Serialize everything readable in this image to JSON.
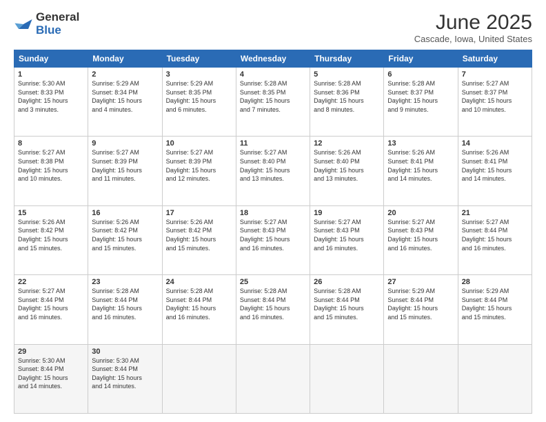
{
  "logo": {
    "general": "General",
    "blue": "Blue"
  },
  "title": "June 2025",
  "subtitle": "Cascade, Iowa, United States",
  "headers": [
    "Sunday",
    "Monday",
    "Tuesday",
    "Wednesday",
    "Thursday",
    "Friday",
    "Saturday"
  ],
  "weeks": [
    [
      {
        "day": "1",
        "rise": "5:30 AM",
        "set": "8:33 PM",
        "daylight": "15 hours and 3 minutes."
      },
      {
        "day": "2",
        "rise": "5:29 AM",
        "set": "8:34 PM",
        "daylight": "15 hours and 4 minutes."
      },
      {
        "day": "3",
        "rise": "5:29 AM",
        "set": "8:35 PM",
        "daylight": "15 hours and 6 minutes."
      },
      {
        "day": "4",
        "rise": "5:28 AM",
        "set": "8:35 PM",
        "daylight": "15 hours and 7 minutes."
      },
      {
        "day": "5",
        "rise": "5:28 AM",
        "set": "8:36 PM",
        "daylight": "15 hours and 8 minutes."
      },
      {
        "day": "6",
        "rise": "5:28 AM",
        "set": "8:37 PM",
        "daylight": "15 hours and 9 minutes."
      },
      {
        "day": "7",
        "rise": "5:27 AM",
        "set": "8:37 PM",
        "daylight": "15 hours and 10 minutes."
      }
    ],
    [
      {
        "day": "8",
        "rise": "5:27 AM",
        "set": "8:38 PM",
        "daylight": "15 hours and 10 minutes."
      },
      {
        "day": "9",
        "rise": "5:27 AM",
        "set": "8:39 PM",
        "daylight": "15 hours and 11 minutes."
      },
      {
        "day": "10",
        "rise": "5:27 AM",
        "set": "8:39 PM",
        "daylight": "15 hours and 12 minutes."
      },
      {
        "day": "11",
        "rise": "5:27 AM",
        "set": "8:40 PM",
        "daylight": "15 hours and 13 minutes."
      },
      {
        "day": "12",
        "rise": "5:26 AM",
        "set": "8:40 PM",
        "daylight": "15 hours and 13 minutes."
      },
      {
        "day": "13",
        "rise": "5:26 AM",
        "set": "8:41 PM",
        "daylight": "15 hours and 14 minutes."
      },
      {
        "day": "14",
        "rise": "5:26 AM",
        "set": "8:41 PM",
        "daylight": "15 hours and 14 minutes."
      }
    ],
    [
      {
        "day": "15",
        "rise": "5:26 AM",
        "set": "8:42 PM",
        "daylight": "15 hours and 15 minutes."
      },
      {
        "day": "16",
        "rise": "5:26 AM",
        "set": "8:42 PM",
        "daylight": "15 hours and 15 minutes."
      },
      {
        "day": "17",
        "rise": "5:26 AM",
        "set": "8:42 PM",
        "daylight": "15 hours and 15 minutes."
      },
      {
        "day": "18",
        "rise": "5:27 AM",
        "set": "8:43 PM",
        "daylight": "15 hours and 16 minutes."
      },
      {
        "day": "19",
        "rise": "5:27 AM",
        "set": "8:43 PM",
        "daylight": "15 hours and 16 minutes."
      },
      {
        "day": "20",
        "rise": "5:27 AM",
        "set": "8:43 PM",
        "daylight": "15 hours and 16 minutes."
      },
      {
        "day": "21",
        "rise": "5:27 AM",
        "set": "8:44 PM",
        "daylight": "15 hours and 16 minutes."
      }
    ],
    [
      {
        "day": "22",
        "rise": "5:27 AM",
        "set": "8:44 PM",
        "daylight": "15 hours and 16 minutes."
      },
      {
        "day": "23",
        "rise": "5:28 AM",
        "set": "8:44 PM",
        "daylight": "15 hours and 16 minutes."
      },
      {
        "day": "24",
        "rise": "5:28 AM",
        "set": "8:44 PM",
        "daylight": "15 hours and 16 minutes."
      },
      {
        "day": "25",
        "rise": "5:28 AM",
        "set": "8:44 PM",
        "daylight": "15 hours and 16 minutes."
      },
      {
        "day": "26",
        "rise": "5:28 AM",
        "set": "8:44 PM",
        "daylight": "15 hours and 15 minutes."
      },
      {
        "day": "27",
        "rise": "5:29 AM",
        "set": "8:44 PM",
        "daylight": "15 hours and 15 minutes."
      },
      {
        "day": "28",
        "rise": "5:29 AM",
        "set": "8:44 PM",
        "daylight": "15 hours and 15 minutes."
      }
    ],
    [
      {
        "day": "29",
        "rise": "5:30 AM",
        "set": "8:44 PM",
        "daylight": "15 hours and 14 minutes."
      },
      {
        "day": "30",
        "rise": "5:30 AM",
        "set": "8:44 PM",
        "daylight": "15 hours and 14 minutes."
      },
      null,
      null,
      null,
      null,
      null
    ]
  ],
  "labels": {
    "sunrise": "Sunrise:",
    "sunset": "Sunset:",
    "daylight": "Daylight:"
  }
}
